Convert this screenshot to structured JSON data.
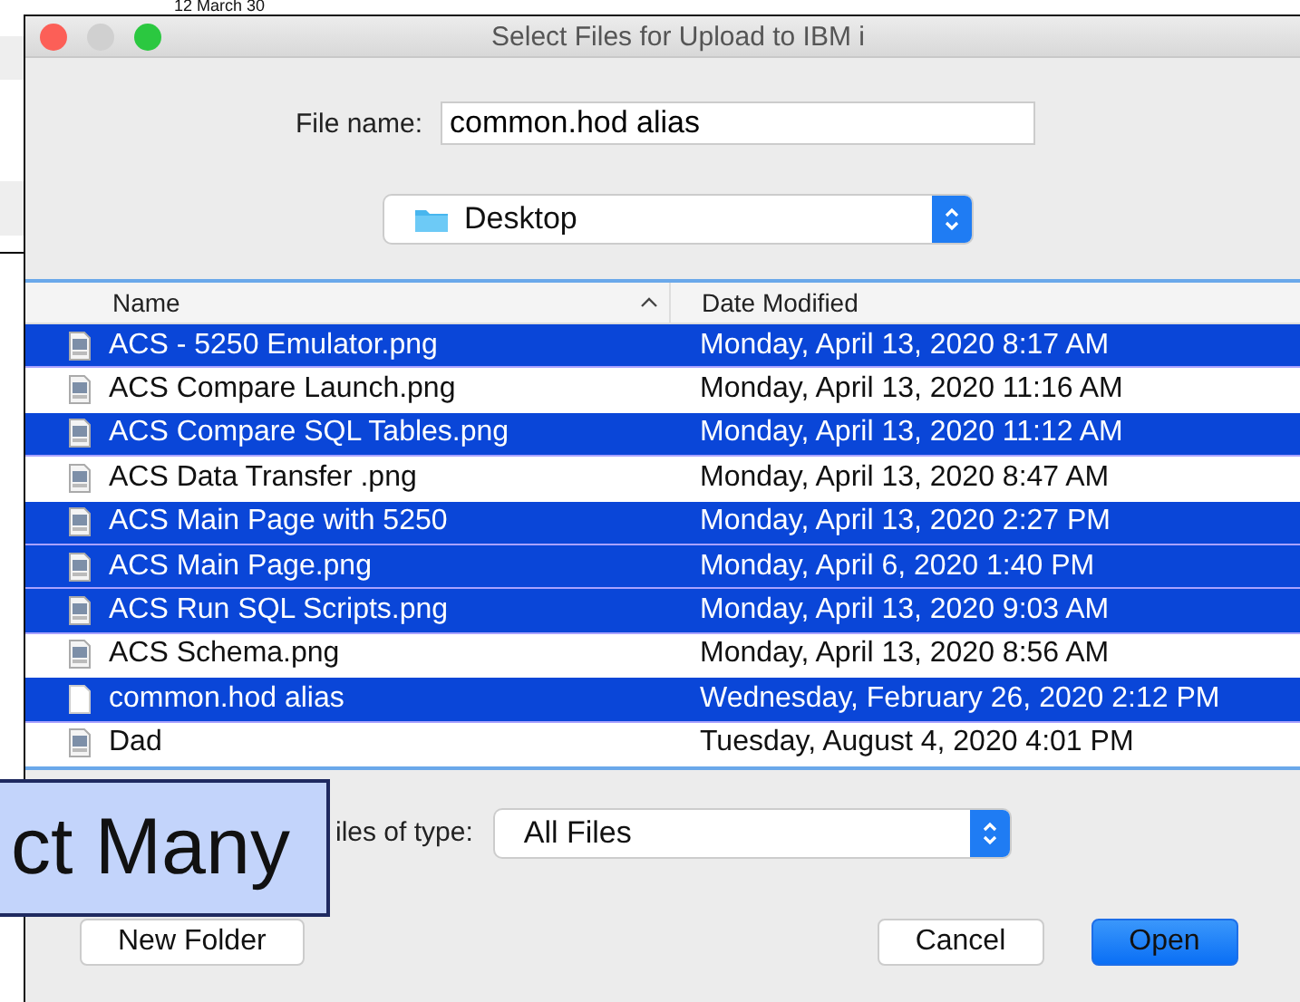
{
  "background": {
    "text": "12 March 30"
  },
  "window": {
    "title": "Select Files for Upload to IBM i"
  },
  "file_name": {
    "label": "File name:",
    "value": "common.hod alias"
  },
  "location": {
    "value": "Desktop"
  },
  "table": {
    "columns": [
      "Name",
      "Date Modified"
    ],
    "rows": [
      {
        "name": "ACS - 5250 Emulator.png",
        "date": "Monday, April 13, 2020 8:17 AM",
        "selected": true,
        "kind": "image"
      },
      {
        "name": "ACS Compare Launch.png",
        "date": "Monday, April 13, 2020 11:16 AM",
        "selected": false,
        "kind": "image"
      },
      {
        "name": "ACS Compare SQL Tables.png",
        "date": "Monday, April 13, 2020 11:12 AM",
        "selected": true,
        "kind": "image"
      },
      {
        "name": "ACS Data Transfer .png",
        "date": "Monday, April 13, 2020 8:47 AM",
        "selected": false,
        "kind": "image"
      },
      {
        "name": "ACS Main Page with 5250",
        "date": "Monday, April 13, 2020 2:27 PM",
        "selected": true,
        "kind": "image"
      },
      {
        "name": "ACS Main Page.png",
        "date": "Monday, April 6, 2020 1:40 PM",
        "selected": true,
        "kind": "image"
      },
      {
        "name": "ACS Run SQL Scripts.png",
        "date": "Monday, April 13, 2020 9:03 AM",
        "selected": true,
        "kind": "image"
      },
      {
        "name": "ACS Schema.png",
        "date": "Monday, April 13, 2020 8:56 AM",
        "selected": false,
        "kind": "image"
      },
      {
        "name": "common.hod alias",
        "date": "Wednesday, February 26, 2020 2:12 PM",
        "selected": true,
        "kind": "alias"
      },
      {
        "name": "Dad",
        "date": "Tuesday, August 4, 2020 4:01 PM",
        "selected": false,
        "kind": "image"
      }
    ]
  },
  "files_of_type": {
    "label": "iles of type:",
    "value": "All Files"
  },
  "buttons": [
    {
      "label": "New Folder",
      "kind": "secondary"
    },
    {
      "label": "Cancel",
      "kind": "secondary"
    },
    {
      "label": "Open",
      "kind": "primary"
    }
  ],
  "callout": {
    "text": "ct Many"
  }
}
